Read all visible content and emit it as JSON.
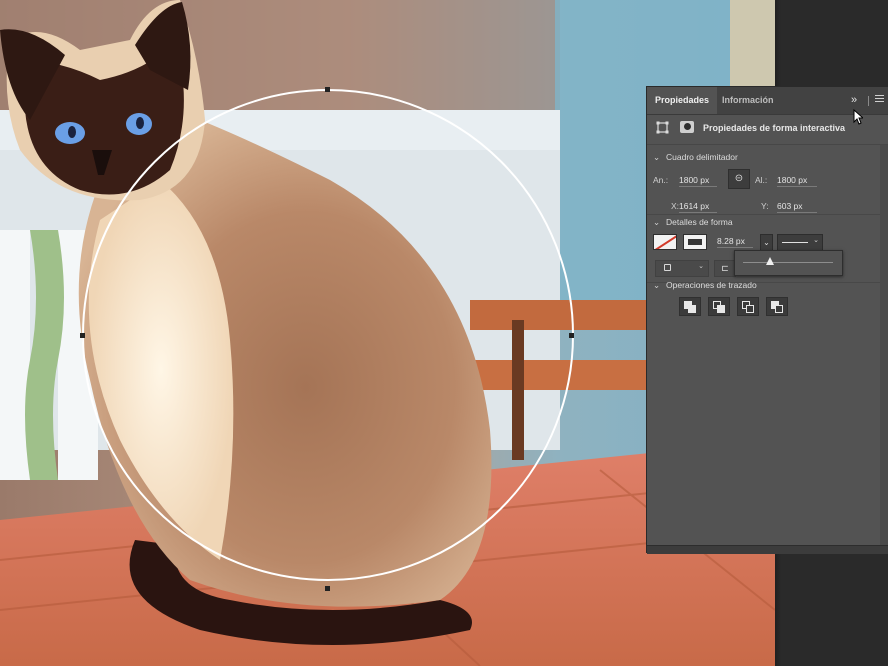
{
  "panel": {
    "tabs": [
      {
        "label": "Propiedades",
        "active": true
      },
      {
        "label": "Información",
        "active": false
      }
    ],
    "collapse_glyph": "»",
    "title": "Propiedades de forma interactiva",
    "bounding_box": {
      "header": "Cuadro delimitador",
      "width_label": "An.:",
      "width_value": "1800 px",
      "height_label": "Al.:",
      "height_value": "1800 px",
      "x_label": "X:",
      "x_value": "1614 px",
      "y_label": "Y:",
      "y_value": "603 px",
      "link_icon": "link-icon"
    },
    "shape_details": {
      "header": "Detalles de forma",
      "fill": "none",
      "stroke_color": "#ffffff",
      "stroke_width": "8.28 px",
      "stroke_width_slider_fraction": 0.3
    },
    "path_operations": {
      "header": "Operaciones de trazado",
      "buttons": [
        "combine-shapes",
        "subtract-front-shape",
        "intersect-shape-areas",
        "exclude-overlapping-shapes"
      ]
    }
  },
  "colors": {
    "panel_bg": "#535353",
    "tab_bar_bg": "#424242",
    "accent_red": "#d23a2a"
  }
}
